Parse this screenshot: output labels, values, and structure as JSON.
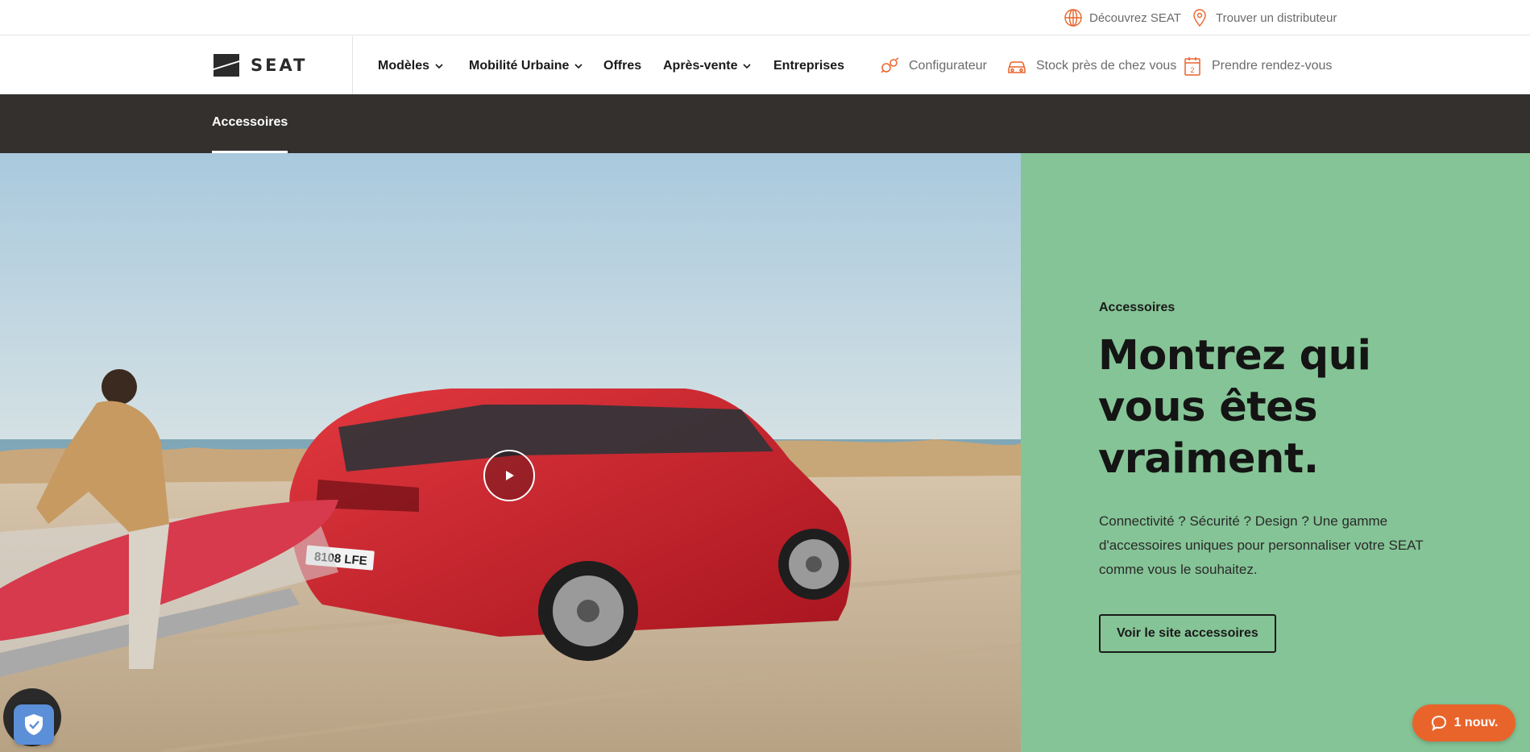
{
  "utility": {
    "discover_label": "Découvrez SEAT",
    "dealer_label": "Trouver un distributeur"
  },
  "brand": {
    "logo_text": "SEAT"
  },
  "nav": {
    "items": [
      {
        "label": "Modèles",
        "dropdown": true
      },
      {
        "label": "Mobilité Urbaine",
        "dropdown": true
      },
      {
        "label": "Offres",
        "dropdown": false
      },
      {
        "label": "Après-vente",
        "dropdown": true
      },
      {
        "label": "Entreprises",
        "dropdown": false
      }
    ],
    "tools": [
      {
        "label": "Configurateur",
        "icon": "configurator-icon"
      },
      {
        "label": "Stock près de chez vous",
        "icon": "car-icon"
      },
      {
        "label": "Prendre rendez-vous",
        "icon": "calendar-icon"
      }
    ],
    "calendar_icon_digit": "2"
  },
  "subnav": {
    "active_tab": "Accessoires"
  },
  "hero": {
    "eyebrow": "Accessoires",
    "headline": "Montrez qui vous êtes vraiment.",
    "body": "Connectivité ? Sécurité ? Design ? Une gamme d'accessoires uniques pour personnaliser votre SEAT comme vous le souhaitez.",
    "cta_label": "Voir le site accessoires",
    "license_plate": "8108 LFE"
  },
  "widgets": {
    "chat_label": "1 nouv."
  },
  "colors": {
    "accent_orange": "#e9642b",
    "subnav_bg": "#33302e",
    "panel_green": "#85c496",
    "privacy_blue": "#5b8fd8"
  }
}
